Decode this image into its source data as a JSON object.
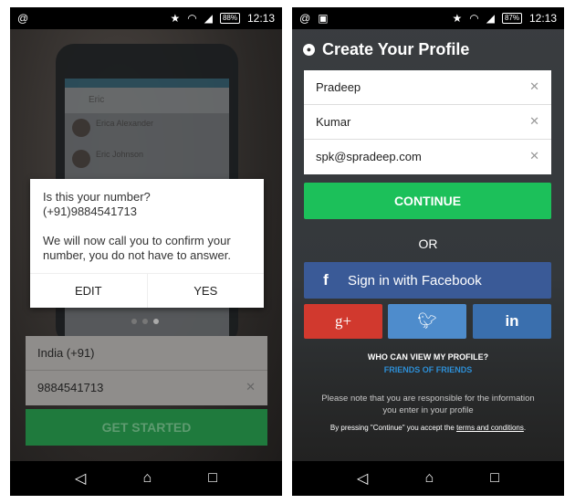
{
  "left": {
    "status": {
      "notification_icon": "at-icon",
      "battery": "88%",
      "time": "12:13"
    },
    "background_phone": {
      "search": "Eric",
      "contacts": [
        "Erica Alexander",
        "Eric Johnson"
      ]
    },
    "dialog": {
      "question": "Is this your number?",
      "number": "(+91)9884541713",
      "message": "We will now call you to confirm your number, you do not have to answer.",
      "edit_label": "EDIT",
      "yes_label": "YES"
    },
    "pager": {
      "count": 3,
      "active": 3
    },
    "country": "India (+91)",
    "phone": "9884541713",
    "get_started_label": "GET STARTED"
  },
  "right": {
    "status": {
      "notification_icon": "at-icon",
      "battery": "87%",
      "time": "12:13"
    },
    "title": "Create Your Profile",
    "fields": {
      "first_name": "Pradeep",
      "last_name": "Kumar",
      "email": "spk@spradeep.com"
    },
    "continue_label": "CONTINUE",
    "or_label": "OR",
    "facebook_label": "Sign in with Facebook",
    "social": {
      "google_plus": "g+",
      "linkedin": "in"
    },
    "who_can_view": "WHO CAN VIEW MY PROFILE?",
    "visibility": "FRIENDS OF FRIENDS",
    "note": "Please note that you are responsible for the information you enter in your profile",
    "terms_prefix": "By pressing \"Continue\" you accept the ",
    "terms_link": "terms and conditions",
    "terms_suffix": "."
  },
  "colors": {
    "green": "#1cc05a",
    "facebook": "#3a5a97",
    "google": "#d1392e",
    "twitter": "#4e8ccc",
    "linkedin": "#3a6fae",
    "link": "#2d8fd6"
  }
}
